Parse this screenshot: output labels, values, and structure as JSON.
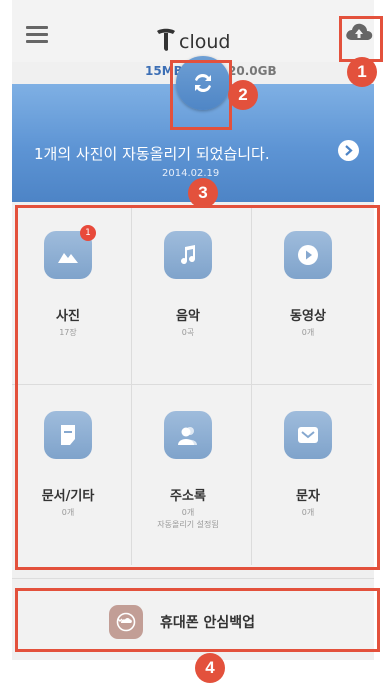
{
  "header": {
    "logo_text": "cloud",
    "storage_used": "15MB",
    "storage_total": "20.0GB"
  },
  "banner": {
    "message": "1개의 사진이 자동올리기 되었습니다.",
    "date": "2014.02.19"
  },
  "grid": {
    "items": [
      {
        "label": "사진",
        "count": "17장",
        "badge": "1",
        "icon": "photo-icon"
      },
      {
        "label": "음악",
        "count": "0곡",
        "icon": "music-icon"
      },
      {
        "label": "동영상",
        "count": "0개",
        "icon": "video-icon"
      },
      {
        "label": "문서/기타",
        "count": "0개",
        "icon": "document-icon"
      },
      {
        "label": "주소록",
        "count": "0개",
        "sub": "자동올리기 설정됨",
        "icon": "contacts-icon"
      },
      {
        "label": "문자",
        "count": "0개",
        "icon": "message-icon"
      }
    ]
  },
  "backup": {
    "label": "휴대폰 안심백업"
  },
  "callouts": [
    "1",
    "2",
    "3",
    "4"
  ],
  "colors": {
    "accent": "#e3513c",
    "banner": "#5d94d4",
    "icon_tile": "#8fb0d4",
    "backup_tile": "#c29e96"
  }
}
